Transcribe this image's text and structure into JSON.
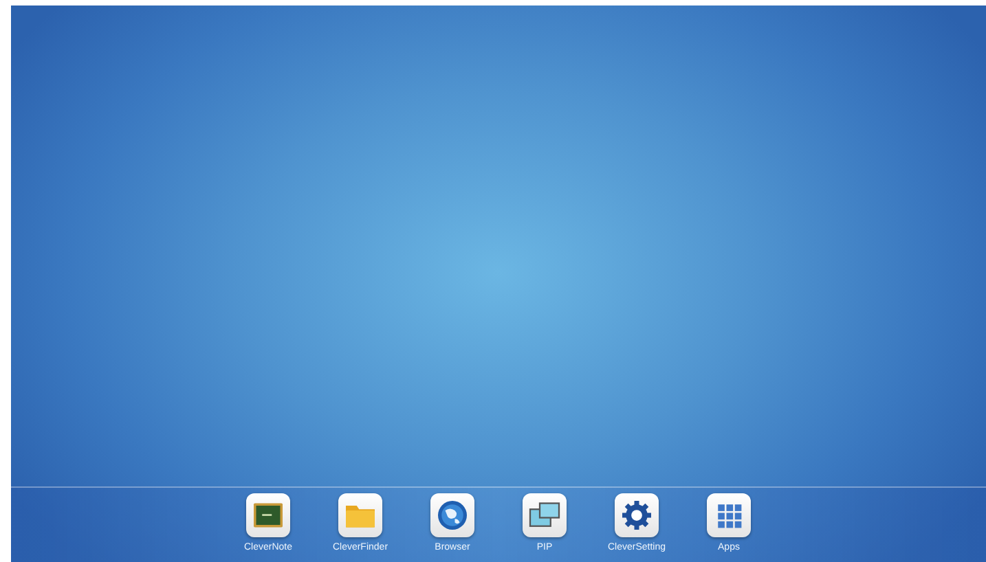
{
  "dock": {
    "apps": [
      {
        "kind": "note",
        "label": "CleverNote"
      },
      {
        "kind": "folder",
        "label": "CleverFinder"
      },
      {
        "kind": "globe",
        "label": "Browser"
      },
      {
        "kind": "pip",
        "label": "PIP"
      },
      {
        "kind": "gear",
        "label": "CleverSetting"
      },
      {
        "kind": "grid",
        "label": "Apps"
      }
    ]
  }
}
